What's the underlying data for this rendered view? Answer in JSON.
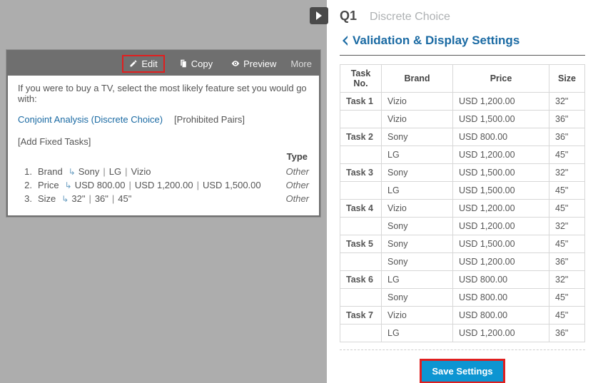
{
  "left": {
    "toolbar": {
      "edit": "Edit",
      "copy": "Copy",
      "preview": "Preview",
      "more": "More"
    },
    "prompt": "If you were to buy a TV, select the most likely feature set you would go with:",
    "analysis_type": "Conjoint Analysis (Discrete Choice)",
    "prohibited_pairs": "[Prohibited Pairs]",
    "add_fixed_tasks": "[Add Fixed Tasks]",
    "type_header": "Type",
    "attributes": [
      {
        "num": "1.",
        "name": "Brand",
        "levels": [
          "Sony",
          "LG",
          "Vizio"
        ],
        "type": "Other"
      },
      {
        "num": "2.",
        "name": "Price",
        "levels": [
          "USD 800.00",
          "USD 1,200.00",
          "USD 1,500.00"
        ],
        "type": "Other"
      },
      {
        "num": "3.",
        "name": "Size",
        "levels": [
          "32\"",
          "36\"",
          "45\""
        ],
        "type": "Other"
      }
    ]
  },
  "right": {
    "q_num": "Q1",
    "q_type": "Discrete Choice",
    "back_label": "Validation & Display Settings",
    "columns": [
      "Task No.",
      "Brand",
      "Price",
      "Size"
    ],
    "tasks": [
      {
        "task": "Task 1",
        "rows": [
          {
            "brand": "Vizio",
            "price": "USD 1,200.00",
            "size": "32\""
          },
          {
            "brand": "Vizio",
            "price": "USD 1,500.00",
            "size": "36\""
          }
        ]
      },
      {
        "task": "Task 2",
        "rows": [
          {
            "brand": "Sony",
            "price": "USD 800.00",
            "size": "36\""
          },
          {
            "brand": "LG",
            "price": "USD 1,200.00",
            "size": "45\""
          }
        ]
      },
      {
        "task": "Task 3",
        "rows": [
          {
            "brand": "Sony",
            "price": "USD 1,500.00",
            "size": "32\""
          },
          {
            "brand": "LG",
            "price": "USD 1,500.00",
            "size": "45\""
          }
        ]
      },
      {
        "task": "Task 4",
        "rows": [
          {
            "brand": "Vizio",
            "price": "USD 1,200.00",
            "size": "45\""
          },
          {
            "brand": "Sony",
            "price": "USD 1,200.00",
            "size": "32\""
          }
        ]
      },
      {
        "task": "Task 5",
        "rows": [
          {
            "brand": "Sony",
            "price": "USD 1,500.00",
            "size": "45\""
          },
          {
            "brand": "Sony",
            "price": "USD 1,200.00",
            "size": "36\""
          }
        ]
      },
      {
        "task": "Task 6",
        "rows": [
          {
            "brand": "LG",
            "price": "USD 800.00",
            "size": "32\""
          },
          {
            "brand": "Sony",
            "price": "USD 800.00",
            "size": "45\""
          }
        ]
      },
      {
        "task": "Task 7",
        "rows": [
          {
            "brand": "Vizio",
            "price": "USD 800.00",
            "size": "45\""
          },
          {
            "brand": "LG",
            "price": "USD 1,200.00",
            "size": "36\""
          }
        ]
      }
    ],
    "save_label": "Save Settings"
  }
}
